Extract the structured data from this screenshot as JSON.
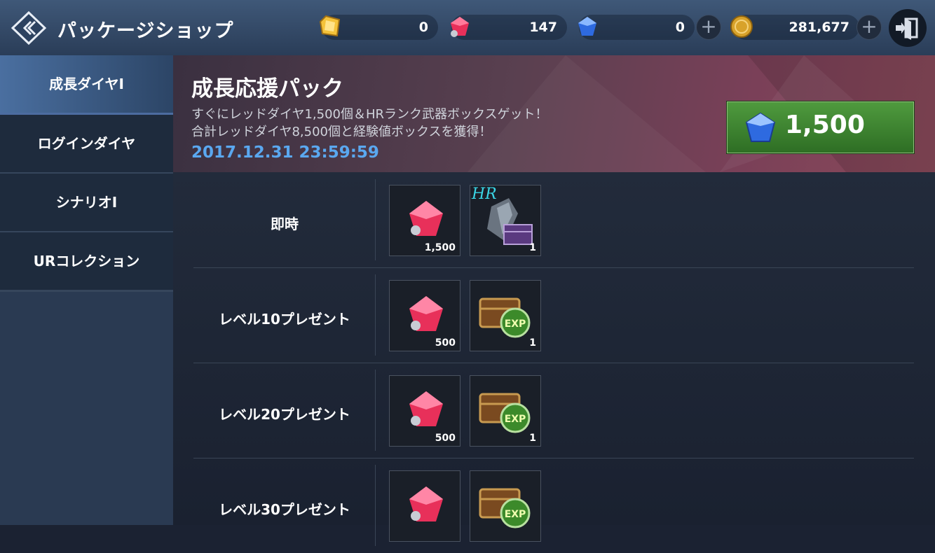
{
  "header": {
    "title": "パッケージショップ",
    "currencies": [
      {
        "name": "yellow-gem",
        "value": "0"
      },
      {
        "name": "red-diamond",
        "value": "147"
      },
      {
        "name": "blue-diamond",
        "value": "0"
      },
      {
        "name": "gold-coin",
        "value": "281,677"
      }
    ],
    "plus_symbol": "+"
  },
  "sidebar": {
    "items": [
      {
        "label": "成長ダイヤⅠ",
        "active": true
      },
      {
        "label": "ログインダイヤ",
        "active": false
      },
      {
        "label": "シナリオⅠ",
        "active": false
      },
      {
        "label": "URコレクション",
        "active": false
      }
    ]
  },
  "banner": {
    "title": "成長応援パック",
    "desc_line1": "すぐにレッドダイヤ1,500個＆HRランク武器ボックスゲット！",
    "desc_line2": "合計レッドダイヤ8,500個と経験値ボックスを獲得！",
    "deadline": "2017.12.31 23:59:59",
    "price": "1,500"
  },
  "rows": [
    {
      "label": "即時",
      "items": [
        {
          "icon": "red-diamond",
          "qty": "1,500"
        },
        {
          "icon": "hr-weapon-box",
          "tag": "HR",
          "qty": "1"
        }
      ]
    },
    {
      "label": "レベル10プレゼント",
      "items": [
        {
          "icon": "red-diamond",
          "qty": "500"
        },
        {
          "icon": "exp-box",
          "qty": "1"
        }
      ]
    },
    {
      "label": "レベル20プレゼント",
      "items": [
        {
          "icon": "red-diamond",
          "qty": "500"
        },
        {
          "icon": "exp-box",
          "qty": "1"
        }
      ]
    },
    {
      "label": "レベル30プレゼント",
      "items": [
        {
          "icon": "red-diamond",
          "qty": ""
        },
        {
          "icon": "exp-box",
          "qty": ""
        }
      ]
    }
  ],
  "exp_text": "EXP"
}
